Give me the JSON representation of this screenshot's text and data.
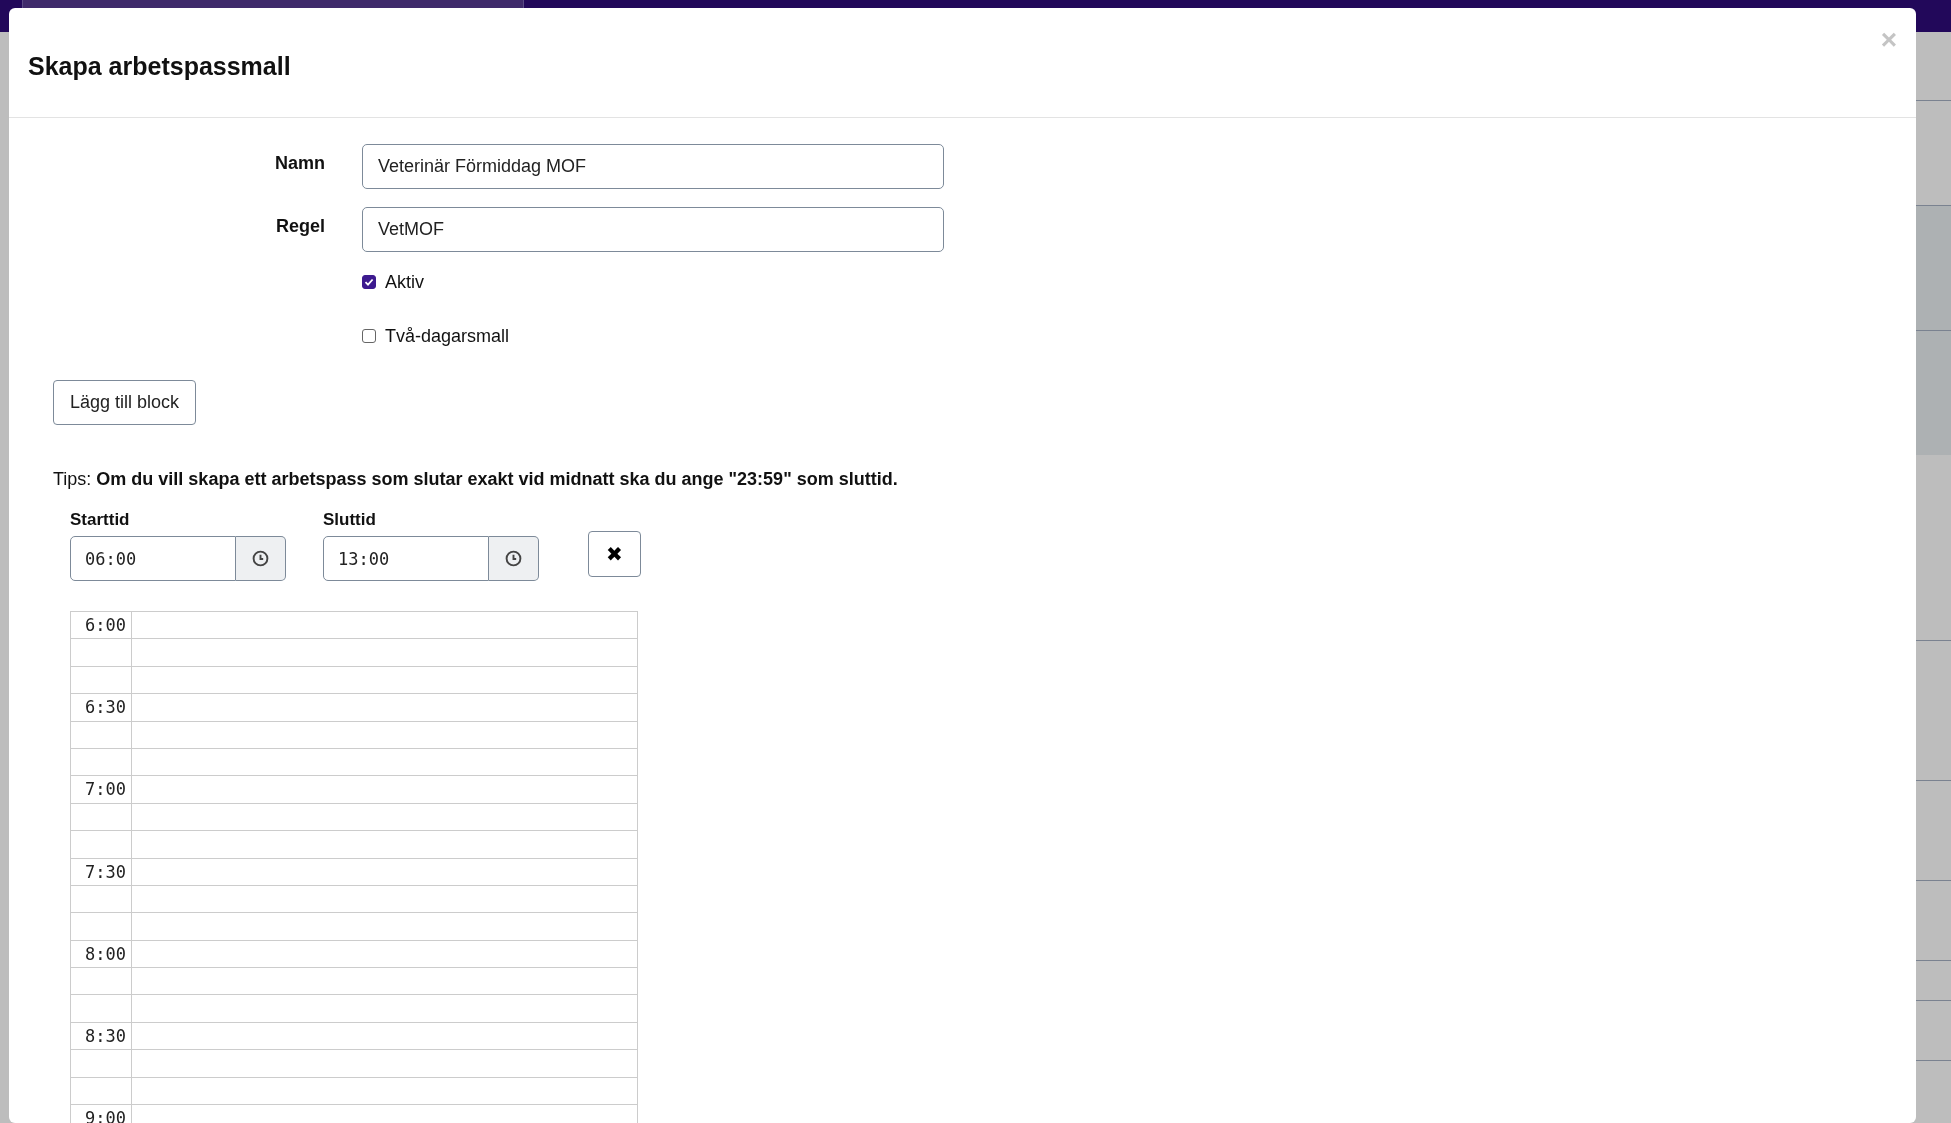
{
  "modal": {
    "title": "Skapa arbetspassmall",
    "close": "×"
  },
  "fields": [
    {
      "label": "Namn",
      "value": "Veterinär Förmiddag MOF"
    },
    {
      "label": "Regel",
      "value": "VetMOF"
    }
  ],
  "checkboxes": [
    {
      "label": "Aktiv",
      "checked": true
    },
    {
      "label": "Två-dagarsmall",
      "checked": false
    }
  ],
  "add_button": "Lägg till block",
  "tip": "Tips: **Om du vill skapa ett arbetspass som slutar exakt vid midnatt ska du ange \"23:59\" som sluttid.**",
  "block": {
    "start": {
      "label": "Starttid",
      "value": "06:00"
    },
    "end": {
      "label": "Sluttid",
      "value": "13:00"
    },
    "remove": "✖"
  },
  "schedule": {
    "time_labels": [
      "6:00",
      "6:30",
      "7:00",
      "7:30",
      "8:00",
      "8:30",
      "9:00"
    ]
  }
}
